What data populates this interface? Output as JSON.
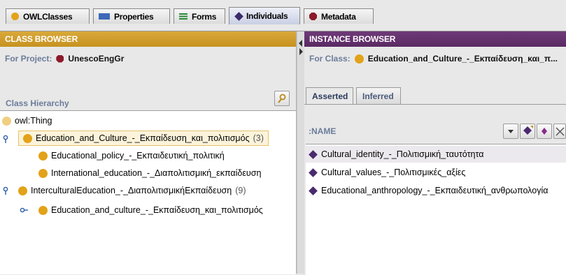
{
  "tabs": [
    {
      "label": "OWLClasses",
      "icon": "class-circle-icon"
    },
    {
      "label": "Properties",
      "icon": "properties-rect-icon"
    },
    {
      "label": "Forms",
      "icon": "forms-lines-icon"
    },
    {
      "label": "Individuals",
      "icon": "individual-diamond-icon",
      "active": true
    },
    {
      "label": "Metadata",
      "icon": "metadata-hexagon-icon"
    }
  ],
  "class_browser": {
    "title": "CLASS BROWSER",
    "for_project_label": "For Project:",
    "project_name": "UnescoEngGr",
    "hierarchy_label": "Class Hierarchy",
    "tree": [
      {
        "label": "owl:Thing",
        "count": ""
      },
      {
        "label": "Education_and_Culture_-_Εκπαίδευση_και_πολιτισμός",
        "count": "(3)"
      },
      {
        "label": "Educational_policy_-_Εκπαιδευτική_πολιτική",
        "count": ""
      },
      {
        "label": "International_education_-_Διαπολιτισμική_εκπαίδευση",
        "count": ""
      },
      {
        "label": "InterculturalEducation_-_ΔιαπολιτισμικήΕκπαίδευση",
        "count": "(9)"
      },
      {
        "label": "Education_and_culture_-_Εκπαίδευση_και_πολιτισμός",
        "count": ""
      }
    ]
  },
  "instance_browser": {
    "title": "INSTANCE BROWSER",
    "for_class_label": "For Class:",
    "class_name": "Education_and_Culture_-_Εκπαίδευση_και_π...",
    "subtabs": [
      "Asserted",
      "Inferred"
    ],
    "column_label": ":NAME",
    "instances": [
      "Cultural_identity_-_Πολιτισμική_ταυτότητα",
      "Cultural_values_-_Πολιτισμικές_αξίες",
      "Educational_anthropology_-_Εκπαιδευτική_ανθρωπολογία"
    ]
  },
  "colors": {
    "class_browser_header": "#c79320",
    "instance_browser_header": "#5a2a63",
    "class_icon": "#e2a219",
    "instance_icon": "#4a2a6e"
  }
}
